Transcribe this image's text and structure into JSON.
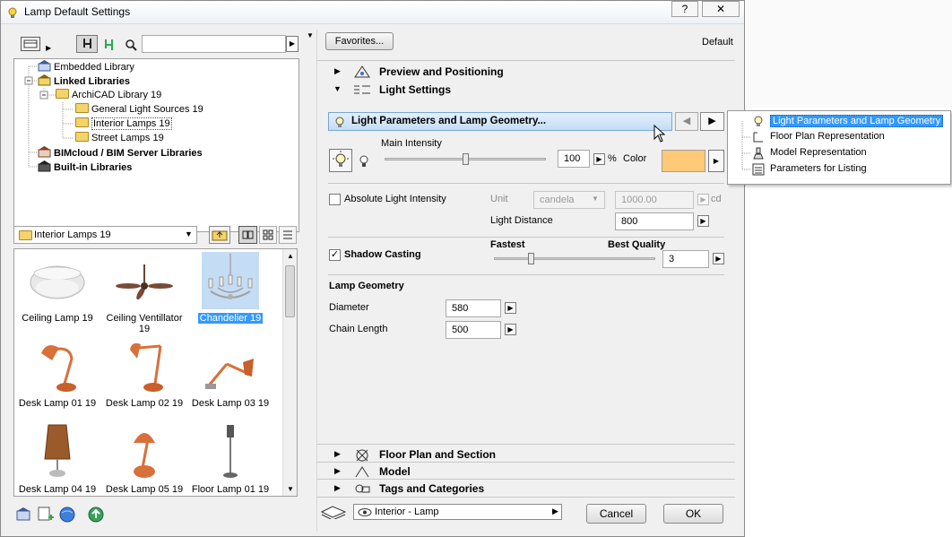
{
  "window": {
    "title": "Lamp Default Settings",
    "help_label": "?",
    "close_label": "✕"
  },
  "library_tree": [
    {
      "label": "Embedded Library",
      "bold": false
    },
    {
      "label": "Linked Libraries",
      "bold": true
    },
    {
      "label": "ArchiCAD Library 19",
      "bold": false
    },
    {
      "label": "General Light Sources 19",
      "bold": false
    },
    {
      "label": "Interior Lamps 19",
      "bold": false
    },
    {
      "label": "Street Lamps 19",
      "bold": false
    },
    {
      "label": "BIMcloud / BIM Server Libraries",
      "bold": true
    },
    {
      "label": "Built-in Libraries",
      "bold": true
    }
  ],
  "search": {
    "value": ""
  },
  "folder_dropdown": {
    "value": "Interior Lamps 19"
  },
  "objects": [
    {
      "label": "Ceiling Lamp 19",
      "selected": false
    },
    {
      "label": "Ceiling Ventillator 19",
      "selected": false
    },
    {
      "label": "Chandelier 19",
      "selected": true
    },
    {
      "label": "Desk Lamp 01 19",
      "selected": false
    },
    {
      "label": "Desk Lamp 02 19",
      "selected": false
    },
    {
      "label": "Desk Lamp 03 19",
      "selected": false
    },
    {
      "label": "Desk Lamp 04 19",
      "selected": false
    },
    {
      "label": "Desk Lamp 05 19",
      "selected": false
    },
    {
      "label": "Floor Lamp 01 19",
      "selected": false
    }
  ],
  "right_header": {
    "favorites_label": "Favorites...",
    "default_label": "Default"
  },
  "sections": {
    "preview": "Preview and Positioning",
    "light_settings": "Light Settings",
    "floor_plan": "Floor Plan and Section",
    "model": "Model",
    "tags": "Tags and Categories"
  },
  "light_page_dropdown": "Light Parameters and Lamp Geometry...",
  "main_intensity": {
    "label": "Main Intensity",
    "value": "100",
    "unit": "%",
    "slider_fraction": 0.5,
    "color_label": "Color",
    "color": "#ffc977"
  },
  "absolute_intensity": {
    "label": "Absolute Light Intensity",
    "checked": false,
    "unit_label": "Unit",
    "unit_value": "candela",
    "value": "1000.00",
    "value_unit": "cd",
    "distance_label": "Light Distance",
    "distance_value": "800"
  },
  "shadow": {
    "label": "Shadow Casting",
    "checked": true,
    "fastest_label": "Fastest",
    "best_label": "Best Quality",
    "value": "3"
  },
  "lamp_geometry": {
    "heading": "Lamp Geometry",
    "diameter_label": "Diameter",
    "diameter_value": "580",
    "chain_label": "Chain Length",
    "chain_value": "500"
  },
  "footer": {
    "layer_value": "Interior - Lamp",
    "cancel_label": "Cancel",
    "ok_label": "OK"
  },
  "popup_items": [
    {
      "label": "Light Parameters and Lamp Geometry",
      "selected": true
    },
    {
      "label": "Floor Plan Representation",
      "selected": false
    },
    {
      "label": "Model Representation",
      "selected": false
    },
    {
      "label": "Parameters for Listing",
      "selected": false
    }
  ],
  "colors": {
    "selection": "#3399ff",
    "accent_bar": "#cfe4fa",
    "lamp_orange": "#d8703a"
  }
}
